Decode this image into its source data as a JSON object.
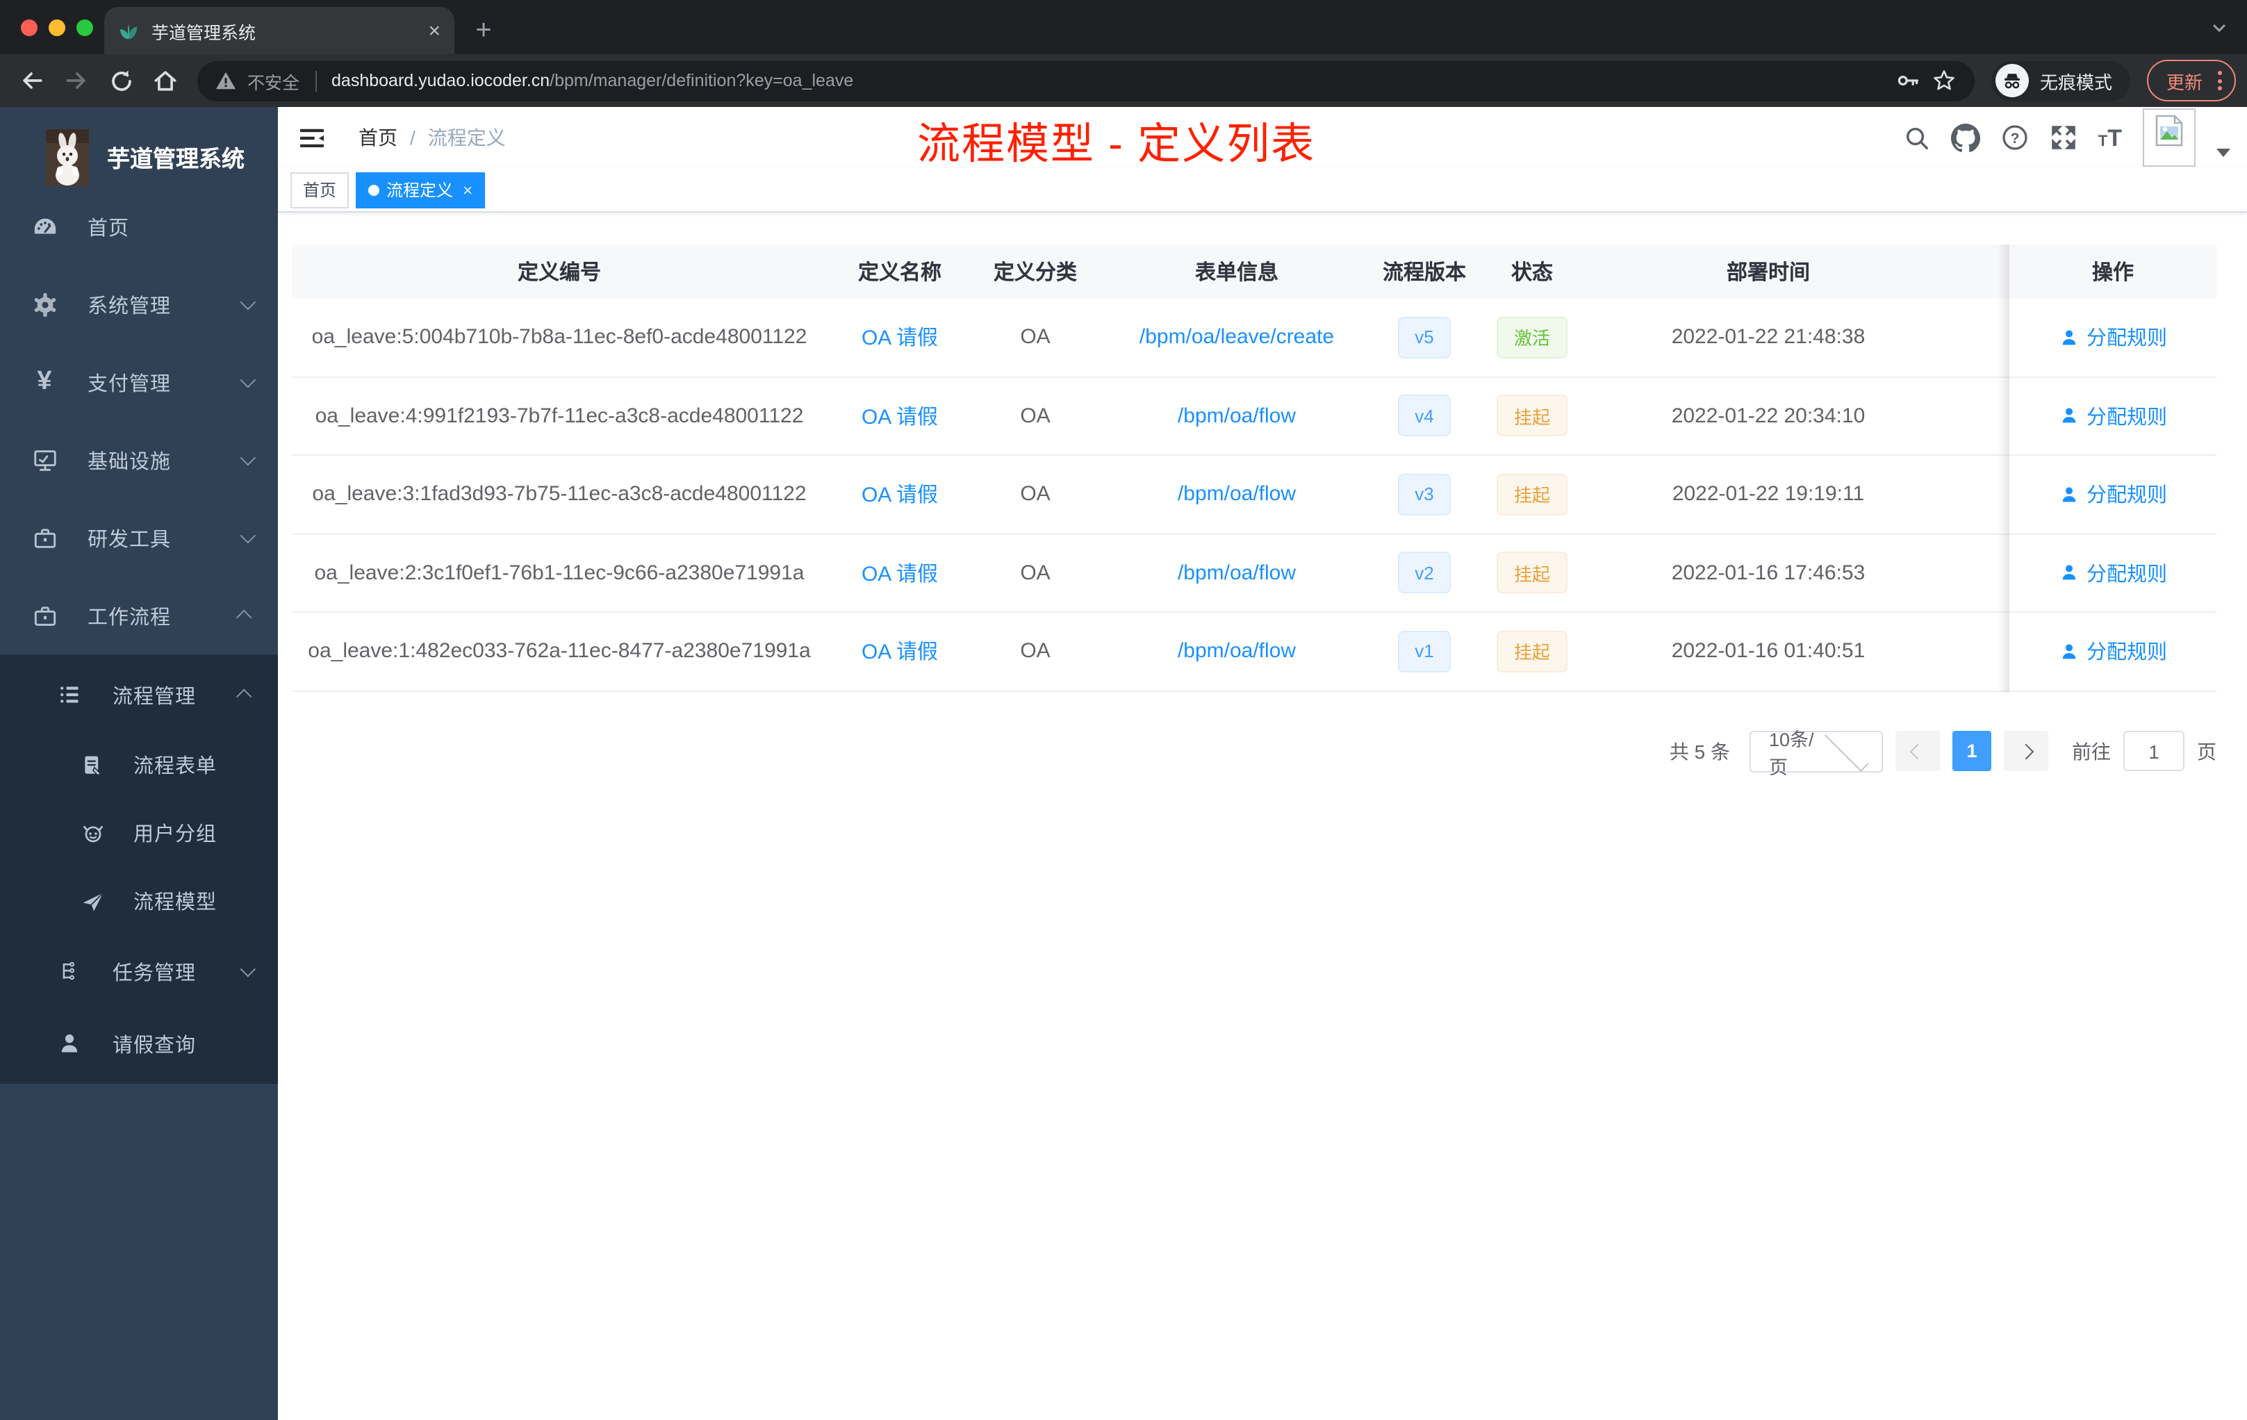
{
  "browser": {
    "tab_title": "芋道管理系统",
    "close_tab": "×",
    "new_tab": "+",
    "url": {
      "warning_label": "不安全",
      "host": "dashboard.yudao.iocoder.cn",
      "path": "/bpm/manager/definition?key=oa_leave"
    },
    "incognito_label": "无痕模式",
    "update_label": "更新",
    "icons": [
      "back-icon",
      "forward-icon",
      "reload-icon",
      "home-icon",
      "warning-icon",
      "key-icon",
      "star-icon",
      "incognito-icon",
      "more-menu-icon"
    ]
  },
  "sidebar": {
    "logo_title": "芋道管理系统",
    "items": [
      {
        "label": "首页",
        "icon": "dashboard-icon"
      },
      {
        "label": "系统管理",
        "icon": "gear-icon",
        "chevron": "down"
      },
      {
        "label": "支付管理",
        "icon": "yen-icon",
        "chevron": "down"
      },
      {
        "label": "基础设施",
        "icon": "monitor-icon",
        "chevron": "down"
      },
      {
        "label": "研发工具",
        "icon": "toolbox-icon",
        "chevron": "down"
      },
      {
        "label": "工作流程",
        "icon": "briefcase-icon",
        "chevron": "up"
      }
    ],
    "submenu": {
      "label": "流程管理",
      "icon": "tree-table-icon",
      "chevron": "up",
      "children": [
        {
          "label": "流程表单",
          "icon": "form-icon"
        },
        {
          "label": "用户分组",
          "icon": "user-group-icon"
        },
        {
          "label": "流程模型",
          "icon": "paper-plane-icon"
        }
      ]
    },
    "items_after": [
      {
        "label": "任务管理",
        "icon": "task-tree-icon",
        "chevron": "down"
      },
      {
        "label": "请假查询",
        "icon": "person-icon"
      }
    ]
  },
  "header": {
    "breadcrumb": {
      "home": "首页",
      "separator": "/",
      "current": "流程定义"
    },
    "annotation": "流程模型 - 定义列表",
    "annotation_color": "#ff2000",
    "icons": [
      "search-icon",
      "github-icon",
      "help-icon",
      "fullscreen-icon",
      "font-size-icon",
      "avatar-broken-image",
      "caret-down-icon"
    ]
  },
  "tags": {
    "home": {
      "label": "首页"
    },
    "active": {
      "label": "流程定义",
      "close": "×"
    }
  },
  "table": {
    "columns": [
      "定义编号",
      "定义名称",
      "定义分类",
      "表单信息",
      "流程版本",
      "状态",
      "部署时间",
      "操作"
    ],
    "rows": [
      {
        "id": "oa_leave:5:004b710b-7b8a-11ec-8ef0-acde48001122",
        "name": "OA 请假",
        "category": "OA",
        "form": "/bpm/oa/leave/create",
        "version": "v5",
        "status": "激活",
        "status_type": "success",
        "deployed_at": "2022-01-22 21:48:38",
        "action": "分配规则"
      },
      {
        "id": "oa_leave:4:991f2193-7b7f-11ec-a3c8-acde48001122",
        "name": "OA 请假",
        "category": "OA",
        "form": "/bpm/oa/flow",
        "version": "v4",
        "status": "挂起",
        "status_type": "warning",
        "deployed_at": "2022-01-22 20:34:10",
        "action": "分配规则"
      },
      {
        "id": "oa_leave:3:1fad3d93-7b75-11ec-a3c8-acde48001122",
        "name": "OA 请假",
        "category": "OA",
        "form": "/bpm/oa/flow",
        "version": "v3",
        "status": "挂起",
        "status_type": "warning",
        "deployed_at": "2022-01-22 19:19:11",
        "action": "分配规则"
      },
      {
        "id": "oa_leave:2:3c1f0ef1-76b1-11ec-9c66-a2380e71991a",
        "name": "OA 请假",
        "category": "OA",
        "form": "/bpm/oa/flow",
        "version": "v2",
        "status": "挂起",
        "status_type": "warning",
        "deployed_at": "2022-01-16 17:46:53",
        "action": "分配规则"
      },
      {
        "id": "oa_leave:1:482ec033-762a-11ec-8477-a2380e71991a",
        "name": "OA 请假",
        "category": "OA",
        "form": "/bpm/oa/flow",
        "version": "v1",
        "status": "挂起",
        "status_type": "warning",
        "deployed_at": "2022-01-16 01:40:51",
        "action": "分配规则"
      }
    ]
  },
  "pagination": {
    "total_text": "共 5 条",
    "page_size": "10条/页",
    "current_page": "1",
    "goto_label": "前往",
    "goto_value": "1",
    "page_unit": "页"
  },
  "colors": {
    "sidebar_bg": "#304156",
    "submenu_bg": "#1f2d3d",
    "sidebar_text": "#bfcbd9",
    "link_blue": "#1890ff",
    "tag_blue": "#409eff",
    "success_green": "#67c23a",
    "warning_orange": "#e6a23c",
    "annotation_red": "#ff2000",
    "active_tag_bg": "#1890ff"
  }
}
